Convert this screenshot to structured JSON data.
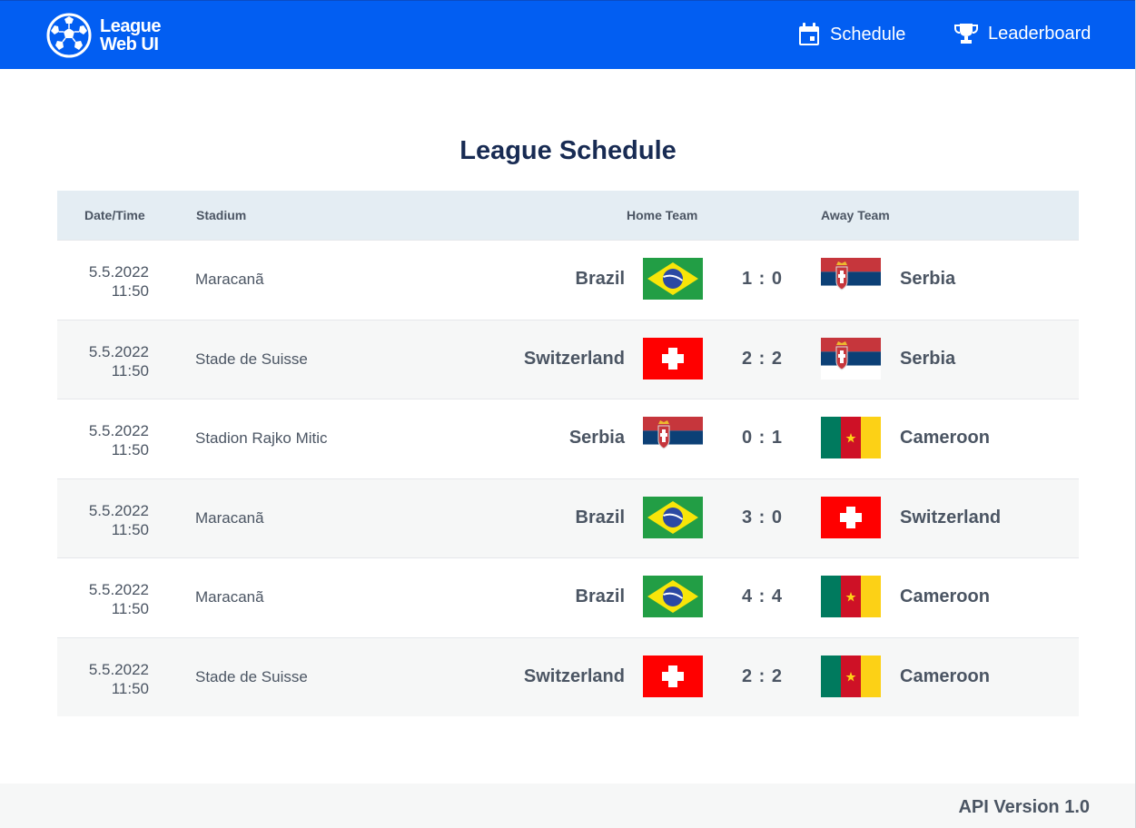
{
  "header": {
    "logo_line1": "League",
    "logo_line2": "Web UI",
    "nav": [
      {
        "label": "Schedule",
        "icon": "calendar-icon"
      },
      {
        "label": "Leaderboard",
        "icon": "trophy-icon"
      }
    ],
    "colors": {
      "bar": "#025ef2"
    }
  },
  "main": {
    "title": "League Schedule",
    "columns": [
      "Date/Time",
      "Stadium",
      "Home Team",
      "Away Team"
    ],
    "matches": [
      {
        "date": "5.5.2022",
        "time": "11:50",
        "stadium": "Maracanã",
        "home": "Brazil",
        "home_flag": "brazil-flag",
        "score": "1 : 0",
        "away": "Serbia",
        "away_flag": "serbia-flag"
      },
      {
        "date": "5.5.2022",
        "time": "11:50",
        "stadium": "Stade de Suisse",
        "home": "Switzerland",
        "home_flag": "switzerland-flag",
        "score": "2 : 2",
        "away": "Serbia",
        "away_flag": "serbia-flag"
      },
      {
        "date": "5.5.2022",
        "time": "11:50",
        "stadium": "Stadion Rajko Mitic",
        "home": "Serbia",
        "home_flag": "serbia-flag",
        "score": "0 : 1",
        "away": "Cameroon",
        "away_flag": "cameroon-flag"
      },
      {
        "date": "5.5.2022",
        "time": "11:50",
        "stadium": "Maracanã",
        "home": "Brazil",
        "home_flag": "brazil-flag",
        "score": "3 : 0",
        "away": "Switzerland",
        "away_flag": "switzerland-flag"
      },
      {
        "date": "5.5.2022",
        "time": "11:50",
        "stadium": "Maracanã",
        "home": "Brazil",
        "home_flag": "brazil-flag",
        "score": "4 : 4",
        "away": "Cameroon",
        "away_flag": "cameroon-flag"
      },
      {
        "date": "5.5.2022",
        "time": "11:50",
        "stadium": "Stade de Suisse",
        "home": "Switzerland",
        "home_flag": "switzerland-flag",
        "score": "2 : 2",
        "away": "Cameroon",
        "away_flag": "cameroon-flag"
      }
    ]
  },
  "footer": {
    "api_version": "API Version 1.0"
  }
}
